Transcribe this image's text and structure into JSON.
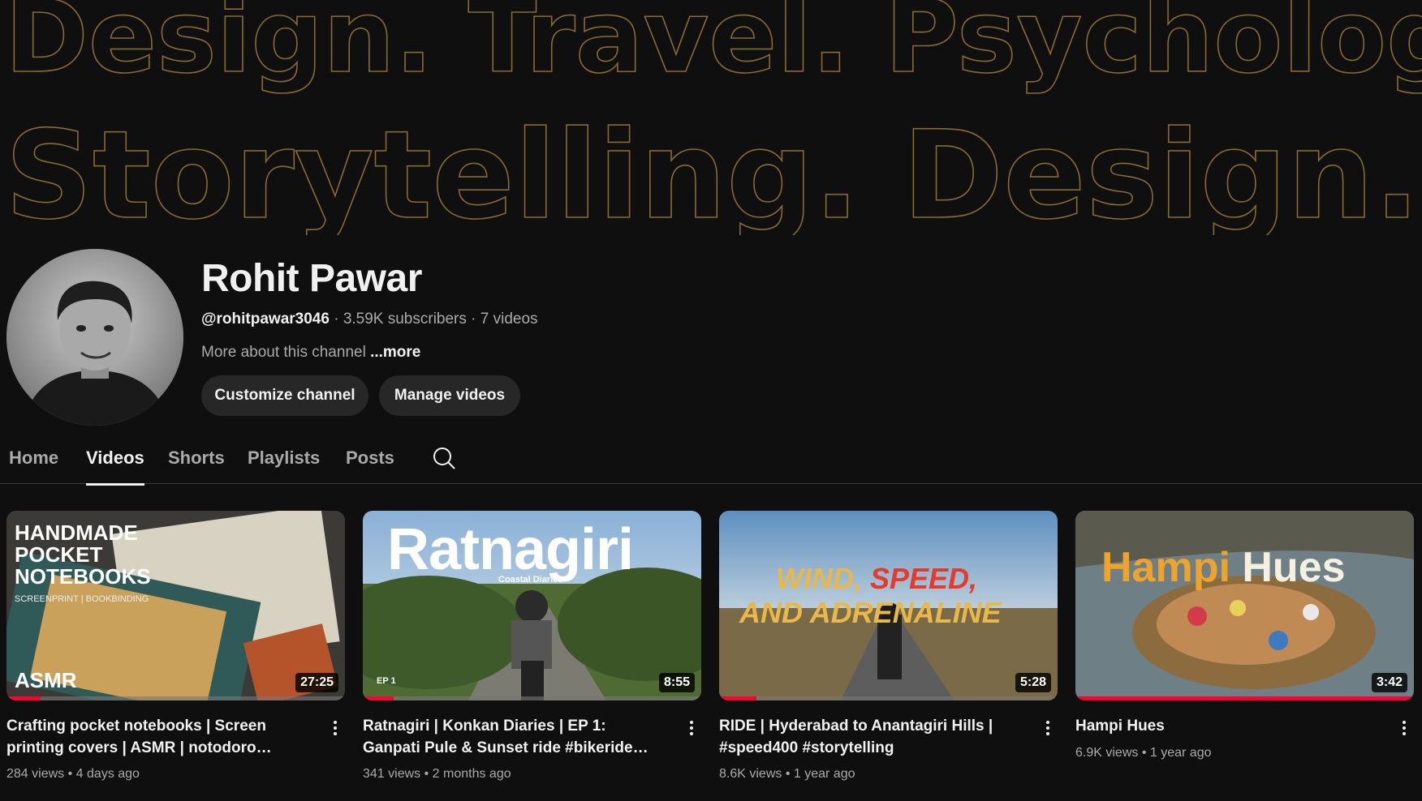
{
  "banner": {
    "line1": "Design. Travel. Psycholog",
    "line2": "Storytelling. Design. Trav"
  },
  "channel": {
    "name": "Rohit Pawar",
    "handle": "@rohitpawar3046",
    "subscribers": "3.59K subscribers",
    "video_count": "7 videos",
    "separator": "·",
    "about": "More about this channel",
    "more_link": "...more",
    "customize_label": "Customize channel",
    "manage_label": "Manage videos"
  },
  "tabs": [
    {
      "label": "Home",
      "active": false
    },
    {
      "label": "Videos",
      "active": true
    },
    {
      "label": "Shorts",
      "active": false
    },
    {
      "label": "Playlists",
      "active": false
    },
    {
      "label": "Posts",
      "active": false
    }
  ],
  "videos": [
    {
      "title": "Crafting pocket notebooks | Screen printing covers | ASMR | notodoro #bookbinding…",
      "views": "284 views",
      "age": "4 days ago",
      "duration": "27:25",
      "progress": 0.1,
      "thumb_text": [
        "HANDMADE",
        "POCKET",
        "NOTEBOOKS"
      ],
      "thumb_sub": "SCREENPRINT | BOOKBINDING",
      "thumb_badge": "ASMR"
    },
    {
      "title": "Ratnagiri | Konkan Diaries | EP 1: Ganpati Pule & Sunset ride #bikeride #ratnagiri…",
      "views": "341 views",
      "age": "2 months ago",
      "duration": "8:55",
      "progress": 0.09,
      "thumb_text": [
        "Ratnagiri"
      ],
      "thumb_sub": "Coastal Diaries",
      "thumb_badge": "EP 1"
    },
    {
      "title": "RIDE | Hyderabad to Anantagiri Hills | #speed400 #storytelling",
      "views": "8.6K views",
      "age": "1 year ago",
      "duration": "5:28",
      "progress": 0.11,
      "thumb_text_1": "WIND, ",
      "thumb_text_2": "SPEED,",
      "thumb_text_3": "AND ADRENALINE"
    },
    {
      "title": "Hampi Hues",
      "views": "6.9K views",
      "age": "1 year ago",
      "duration": "3:42",
      "progress": 1.0,
      "thumb_text_1": "Hampi",
      "thumb_text_2": "Hues"
    }
  ],
  "stat_separator": "•",
  "colors": {
    "background": "#0f0f0f",
    "accent_red": "#ff0033",
    "banner_stroke": "#8a6a33",
    "chip_bg": "#272727"
  }
}
